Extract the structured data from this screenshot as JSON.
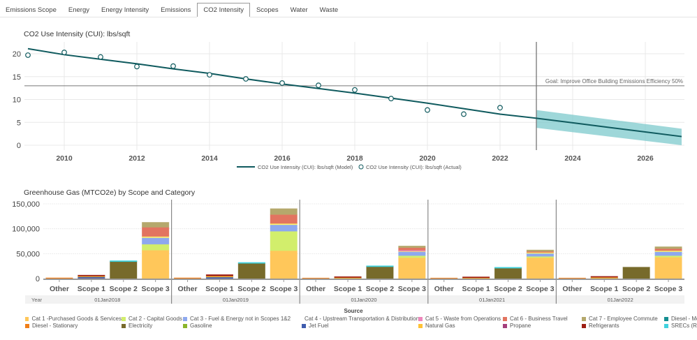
{
  "tabs": [
    {
      "label": "Emissions Scope"
    },
    {
      "label": "Energy"
    },
    {
      "label": "Energy Intensity"
    },
    {
      "label": "Emissions"
    },
    {
      "label": "CO2 Intensity",
      "active": true
    },
    {
      "label": "Scopes"
    },
    {
      "label": "Water"
    },
    {
      "label": "Waste"
    }
  ],
  "chart_data": [
    {
      "type": "line",
      "title": "CO2 Use Intensity (CUI): lbs/sqft",
      "xlim": [
        2009,
        2027
      ],
      "ylim": [
        0,
        22
      ],
      "x_ticks": [
        "2010",
        "2012",
        "2014",
        "2016",
        "2018",
        "2020",
        "2022",
        "2024",
        "2026"
      ],
      "y_ticks": [
        "0",
        "5",
        "10",
        "15",
        "20"
      ],
      "grid": true,
      "goal": {
        "value": 13,
        "label": "Goal: Improve Office Building Emissions Efficiency 50%"
      },
      "forecast_start": 2023,
      "series": [
        {
          "name": "CO2 Use Intensity (CUI): lbs/sqft (Model)",
          "type": "line",
          "color": "#0f5a5e",
          "x": [
            2009,
            2010,
            2011,
            2012,
            2013,
            2014,
            2015,
            2016,
            2017,
            2018,
            2019,
            2020,
            2021,
            2022,
            2023,
            2024,
            2025,
            2026,
            2027
          ],
          "y": [
            21.1,
            19.8,
            18.8,
            17.8,
            16.7,
            15.7,
            14.5,
            13.4,
            12.4,
            11.4,
            10.3,
            9.2,
            8.0,
            6.8,
            5.9,
            4.9,
            3.9,
            2.9,
            1.9
          ]
        },
        {
          "name": "CO2 Use Intensity (CUI): lbs/sqft (Actual)",
          "type": "scatter",
          "color": "#0f5a5e",
          "x": [
            2009,
            2010,
            2011,
            2012,
            2013,
            2014,
            2015,
            2016,
            2017,
            2018,
            2019,
            2020,
            2021,
            2022
          ],
          "y": [
            19.7,
            20.3,
            19.3,
            17.2,
            17.3,
            15.4,
            14.5,
            13.6,
            13.1,
            12.1,
            10.2,
            7.7,
            6.8,
            8.2
          ]
        }
      ],
      "forecast_band": {
        "color": "#7ec9cc",
        "x": [
          2023,
          2027
        ],
        "lower": [
          3.8,
          0
        ],
        "upper": [
          7.7,
          3.6
        ]
      },
      "legend_placement": "bottom"
    },
    {
      "type": "bar",
      "stacked": true,
      "title": "Greenhouse Gas (MTCO2e) by Scope and Category",
      "ylim": [
        0,
        150000
      ],
      "y_ticks": [
        "0",
        "50,000",
        "100,000",
        "150,000"
      ],
      "group_axis_label": "Year",
      "groups": [
        "01Jan2018",
        "01Jan2019",
        "01Jan2020",
        "01Jan2021",
        "01Jan2022"
      ],
      "categories": [
        "Other",
        "Scope 1",
        "Scope 2",
        "Scope 3"
      ],
      "legend_title": "Source",
      "sources": [
        {
          "name": "Cat 1 -Purchased Goods & Services",
          "color": "#ffc75a"
        },
        {
          "name": "Cat 2 - Capital Goods",
          "color": "#d2ee6c"
        },
        {
          "name": "Cat 3 - Fuel & Energy not in Scopes 1&2",
          "color": "#8ea8ee"
        },
        {
          "name": "Cat 4 - Upstream Transportation & Distribution",
          "color": "#fff36a"
        },
        {
          "name": "Cat 5 - Waste from Operations",
          "color": "#ee86bb"
        },
        {
          "name": "Cat 6 - Business Travel",
          "color": "#e27460"
        },
        {
          "name": "Cat 7 - Employee Commute",
          "color": "#b5a86c"
        },
        {
          "name": "Diesel - Mobile",
          "color": "#148e91"
        },
        {
          "name": "Diesel - Stationary",
          "color": "#f07e18"
        },
        {
          "name": "Electricity",
          "color": "#776a2b"
        },
        {
          "name": "Gasoline",
          "color": "#8ab52c"
        },
        {
          "name": "Jet Fuel",
          "color": "#3f5cae"
        },
        {
          "name": "Natural Gas",
          "color": "#ffc236"
        },
        {
          "name": "Propane",
          "color": "#a43f7c"
        },
        {
          "name": "Refrigerants",
          "color": "#9d1e13"
        },
        {
          "name": "SRECs (Retired)",
          "color": "#40d2df"
        }
      ],
      "data": {
        "01Jan2018": {
          "Other": {
            "Diesel - Stationary": 1500
          },
          "Scope 1": {
            "Jet Fuel": 3000,
            "Natural Gas": 2000,
            "Diesel - Stationary": 500,
            "Refrigerants": 1500
          },
          "Scope 2": {
            "Electricity": 35000,
            "SRECs (Retired)": 1000
          },
          "Scope 3": {
            "Cat 1 -Purchased Goods & Services": 57000,
            "Cat 2 - Capital Goods": 12000,
            "Cat 3 - Fuel & Energy not in Scopes 1&2": 13000,
            "Cat 4 - Upstream Transportation & Distribution": 2500,
            "Cat 6 - Business Travel": 18500,
            "Cat 7 - Employee Commute": 10000
          }
        },
        "01Jan2019": {
          "Other": {
            "Diesel - Stationary": 1500
          },
          "Scope 1": {
            "Jet Fuel": 3000,
            "Natural Gas": 2000,
            "Refrigerants": 3000
          },
          "Scope 2": {
            "Electricity": 31000,
            "SRECs (Retired)": 1500
          },
          "Scope 3": {
            "Cat 1 -Purchased Goods & Services": 56000,
            "Cat 2 - Capital Goods": 39000,
            "Cat 3 - Fuel & Energy not in Scopes 1&2": 13000,
            "Cat 4 - Upstream Transportation & Distribution": 2500,
            "Cat 6 - Business Travel": 18000,
            "Cat 7 - Employee Commute": 12000
          }
        },
        "01Jan2020": {
          "Other": {
            "Diesel - Stationary": 1200
          },
          "Scope 1": {
            "Jet Fuel": 1000,
            "Natural Gas": 1500,
            "Refrigerants": 1500
          },
          "Scope 2": {
            "Electricity": 25000,
            "SRECs (Retired)": 800
          },
          "Scope 3": {
            "Cat 1 -Purchased Goods & Services": 42000,
            "Cat 2 - Capital Goods": 4000,
            "Cat 3 - Fuel & Energy not in Scopes 1&2": 9000,
            "Cat 4 - Upstream Transportation & Distribution": 1000,
            "Cat 5 - Waste from Operations": 1000,
            "Cat 6 - Business Travel": 5000,
            "Cat 7 - Employee Commute": 3500
          }
        },
        "01Jan2021": {
          "Other": {
            "Diesel - Stationary": 1200
          },
          "Scope 1": {
            "Jet Fuel": 800,
            "Natural Gas": 1200,
            "Refrigerants": 1500
          },
          "Scope 2": {
            "Electricity": 22000,
            "SRECs (Retired)": 800
          },
          "Scope 3": {
            "Cat 1 -Purchased Goods & Services": 42000,
            "Cat 2 - Capital Goods": 2500,
            "Cat 3 - Fuel & Energy not in Scopes 1&2": 7000,
            "Cat 4 - Upstream Transportation & Distribution": 1000,
            "Cat 6 - Business Travel": 2000,
            "Cat 7 - Employee Commute": 3000
          }
        },
        "01Jan2022": {
          "Other": {
            "Diesel - Stationary": 1200
          },
          "Scope 1": {
            "Jet Fuel": 1500,
            "Natural Gas": 1000,
            "Refrigerants": 2000
          },
          "Scope 2": {
            "Electricity": 23000
          },
          "Scope 3": {
            "Cat 1 -Purchased Goods & Services": 43000,
            "Cat 2 - Capital Goods": 3000,
            "Cat 3 - Fuel & Energy not in Scopes 1&2": 9000,
            "Cat 4 - Upstream Transportation & Distribution": 1000,
            "Cat 6 - Business Travel": 4000,
            "Cat 7 - Employee Commute": 4000
          }
        }
      },
      "legend_placement": "bottom"
    }
  ]
}
